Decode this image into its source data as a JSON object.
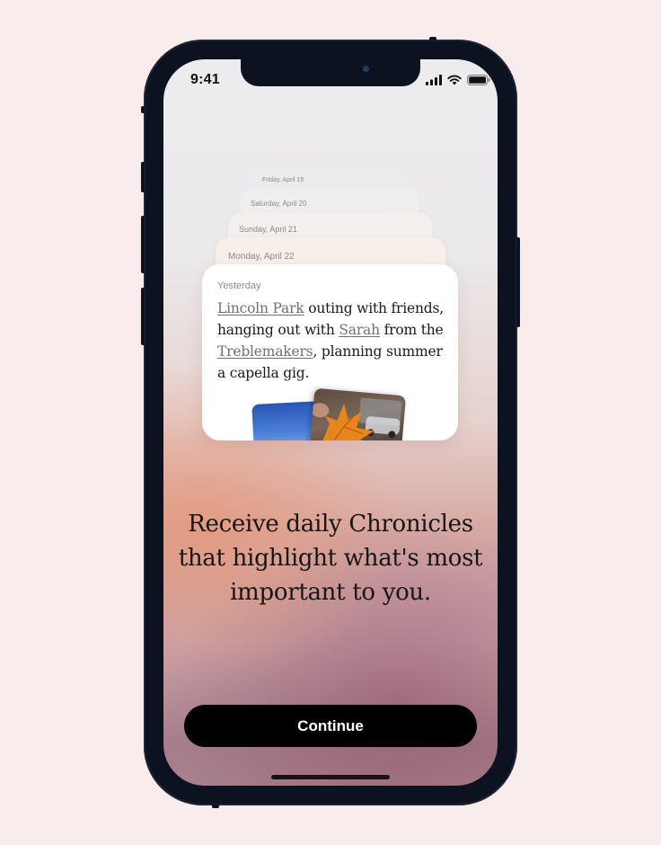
{
  "status_bar": {
    "time": "9:41",
    "icons": [
      "cellular-signal-icon",
      "wifi-icon",
      "battery-icon"
    ]
  },
  "card_stack": [
    {
      "date": "Friday, April 19"
    },
    {
      "date": "Saturday, April 20"
    },
    {
      "date": "Sunday, April 21"
    },
    {
      "date": "Monday, April 22"
    }
  ],
  "chronicle_card": {
    "date": "Yesterday",
    "segments": [
      {
        "text": "Lincoln Park",
        "link": true
      },
      {
        "text": " outing with friends, hanging out with ",
        "link": false
      },
      {
        "text": "Sarah",
        "link": true
      },
      {
        "text": " from the ",
        "link": false
      },
      {
        "text": "Treblemakers",
        "link": true
      },
      {
        "text": ", planning summer a capella gig.",
        "link": false
      }
    ]
  },
  "headline": "Receive daily Chronicles that highlight what's most important to you.",
  "cta": {
    "label": "Continue"
  },
  "colors": {
    "background": "#f9ecec",
    "phone_frame": "#0d1220",
    "button": "#000000",
    "link": "#707075"
  }
}
